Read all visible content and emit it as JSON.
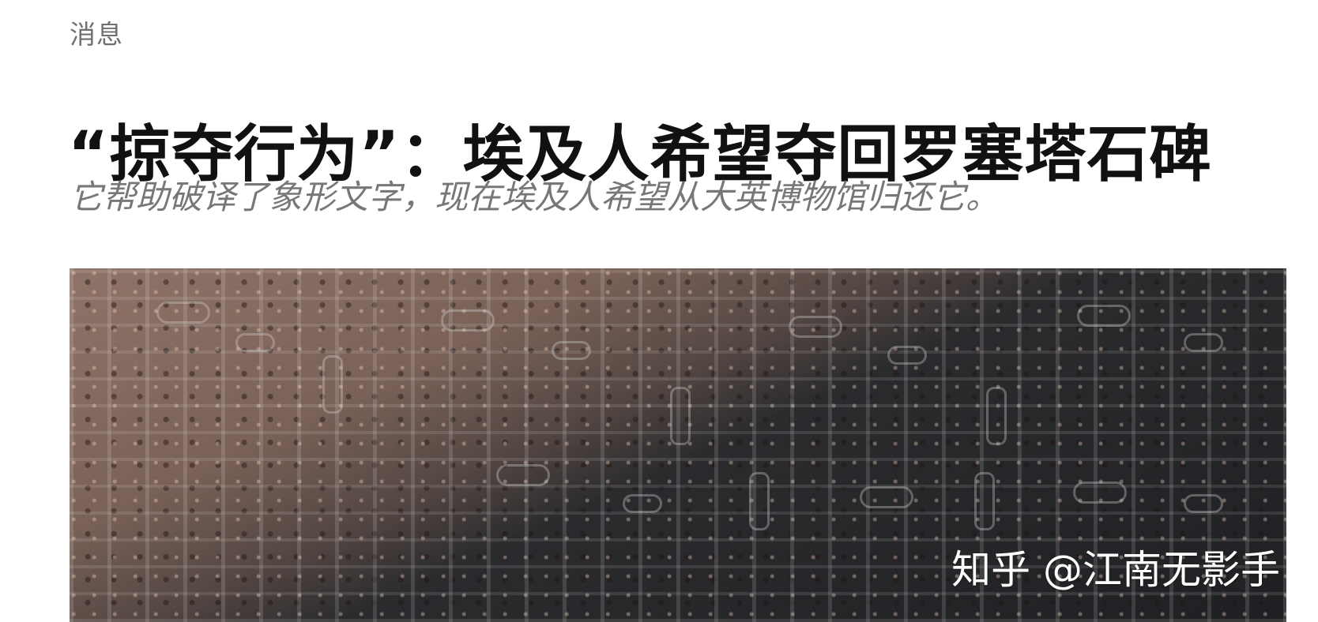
{
  "article": {
    "section": "消息",
    "title": "“掠夺行为”：埃及人希望夺回罗塞塔石碑",
    "subtitle": "它帮助破译了象形文字，现在埃及人希望从大英博物馆归还它。"
  },
  "hero_image": {
    "watermark": "知乎 @江南无影手"
  }
}
